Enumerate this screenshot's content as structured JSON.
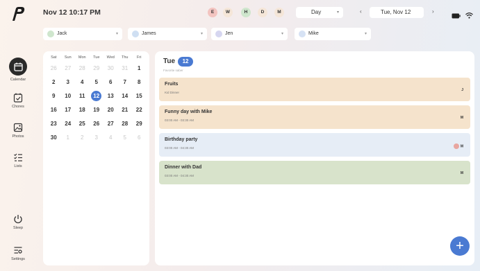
{
  "sidebar": {
    "items": [
      {
        "label": "Calendar",
        "icon": "calendar-icon"
      },
      {
        "label": "Chores",
        "icon": "chores-icon"
      },
      {
        "label": "Photos",
        "icon": "photos-icon"
      },
      {
        "label": "Lists",
        "icon": "lists-icon"
      },
      {
        "label": "Sleep",
        "icon": "power-icon"
      },
      {
        "label": "Settings",
        "icon": "settings-icon"
      }
    ]
  },
  "header": {
    "datetime": "Nov 12 10:17 PM",
    "filters": [
      {
        "label": "E",
        "color": "#f3c4c0"
      },
      {
        "label": "W",
        "color": "#f5e6d8"
      },
      {
        "label": "H",
        "color": "#cfe6cd"
      },
      {
        "label": "D",
        "color": "#f5e6d8"
      },
      {
        "label": "M",
        "color": "#f5e6d8"
      }
    ],
    "view": "Day",
    "prev": "‹",
    "next": "›",
    "date": "Tue, Nov 12"
  },
  "users": [
    {
      "name": "Jack",
      "color": "#cfe6cd"
    },
    {
      "name": "James",
      "color": "#cfdff2"
    },
    {
      "name": "Jen",
      "color": "#d6d6f0"
    },
    {
      "name": "Mike",
      "color": "#d6e2f4"
    }
  ],
  "mini_calendar": {
    "weekdays": [
      "Sat",
      "Sun",
      "Mon",
      "Tue",
      "Wed",
      "Thu",
      "Fri"
    ],
    "weeks": [
      [
        {
          "d": "26",
          "m": true
        },
        {
          "d": "27",
          "m": true
        },
        {
          "d": "28",
          "m": true
        },
        {
          "d": "29",
          "m": true
        },
        {
          "d": "30",
          "m": true
        },
        {
          "d": "31",
          "m": true
        },
        {
          "d": "1"
        }
      ],
      [
        {
          "d": "2"
        },
        {
          "d": "3"
        },
        {
          "d": "4"
        },
        {
          "d": "5"
        },
        {
          "d": "6"
        },
        {
          "d": "7"
        },
        {
          "d": "8"
        }
      ],
      [
        {
          "d": "9"
        },
        {
          "d": "10"
        },
        {
          "d": "11"
        },
        {
          "d": "12",
          "today": true
        },
        {
          "d": "13"
        },
        {
          "d": "14"
        },
        {
          "d": "15"
        }
      ],
      [
        {
          "d": "16"
        },
        {
          "d": "17"
        },
        {
          "d": "18"
        },
        {
          "d": "19"
        },
        {
          "d": "20"
        },
        {
          "d": "21"
        },
        {
          "d": "22"
        }
      ],
      [
        {
          "d": "23"
        },
        {
          "d": "24"
        },
        {
          "d": "25"
        },
        {
          "d": "26"
        },
        {
          "d": "27"
        },
        {
          "d": "28"
        },
        {
          "d": "29"
        }
      ],
      [
        {
          "d": "30"
        },
        {
          "d": "1",
          "m": true
        },
        {
          "d": "2",
          "m": true
        },
        {
          "d": "3",
          "m": true
        },
        {
          "d": "4",
          "m": true
        },
        {
          "d": "5",
          "m": true
        },
        {
          "d": "6",
          "m": true
        }
      ]
    ]
  },
  "day_view": {
    "weekday": "Tue",
    "day_number": "12",
    "subtitle": "Favorite saber",
    "events": [
      {
        "title": "Fruits",
        "time": "Kid Dinner",
        "assignee": "J",
        "color": "#f5e3cc"
      },
      {
        "title": "Funny day with Mike",
        "time": "03:00 AM - 03:30 AM",
        "assignee": "M",
        "color": "#f5e3cc"
      },
      {
        "title": "Birthday party",
        "time": "03:00 AM - 04:30 AM",
        "assignee": "M",
        "color": "#e6edf6"
      },
      {
        "title": "Dinner with Dad",
        "time": "03:00 AM - 04:30 AM",
        "assignee": "M",
        "color": "#d8e3cb"
      }
    ]
  },
  "fab": "+"
}
